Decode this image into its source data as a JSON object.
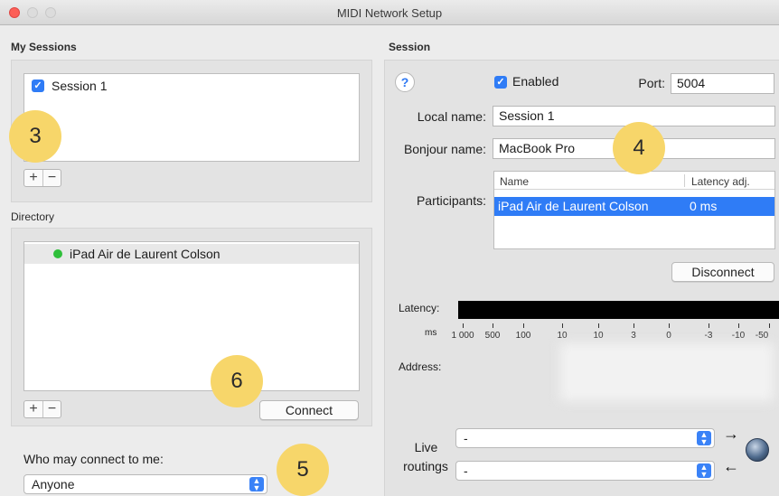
{
  "window": {
    "title": "MIDI Network Setup"
  },
  "my_sessions": {
    "label": "My Sessions",
    "items": [
      {
        "label": "Session 1",
        "checked": true
      }
    ],
    "add_label": "+",
    "remove_label": "−"
  },
  "directory": {
    "label": "Directory",
    "items": [
      {
        "label": "iPad Air de Laurent Colson",
        "status": "online",
        "status_color": "#2fbf3a"
      }
    ],
    "add_label": "+",
    "remove_label": "−",
    "connect_label": "Connect"
  },
  "who_may_connect": {
    "label": "Who may connect to me:",
    "value": "Anyone"
  },
  "session": {
    "label": "Session",
    "help_label": "?",
    "enabled_label": "Enabled",
    "enabled": true,
    "port_label": "Port:",
    "port_value": "5004",
    "local_name_label": "Local name:",
    "local_name_value": "Session 1",
    "bonjour_name_label": "Bonjour name:",
    "bonjour_name_value": "MacBook Pro",
    "participants_label": "Participants:",
    "participants_columns": [
      "Name",
      "Latency adj."
    ],
    "participants_rows": [
      {
        "name": "iPad Air de Laurent Colson",
        "latency": "0 ms"
      }
    ],
    "disconnect_label": "Disconnect",
    "latency_label": "Latency:",
    "ms_label": "ms",
    "latency_ticks": [
      "1 000",
      "500",
      "100",
      "10",
      "10",
      "3",
      "0",
      "-3",
      "-10",
      "-50"
    ],
    "address_label": "Address:",
    "live_routings_label_1": "Live",
    "live_routings_label_2": "routings",
    "routing_in_value": "-",
    "routing_out_value": "-",
    "arrow_right": "→",
    "arrow_left": "←"
  },
  "callouts": {
    "c3": "3",
    "c4": "4",
    "c5": "5",
    "c6": "6"
  },
  "colors": {
    "accent": "#2f7cf6",
    "callout": "#f7d66a",
    "selection": "#2f7cf6"
  },
  "icons": [
    "close-icon",
    "minimize-icon",
    "maximize-icon",
    "checkbox-checked-icon",
    "help-icon",
    "status-dot-icon",
    "popup-stepper-icon",
    "globe-icon",
    "arrow-right-icon",
    "arrow-left-icon"
  ]
}
